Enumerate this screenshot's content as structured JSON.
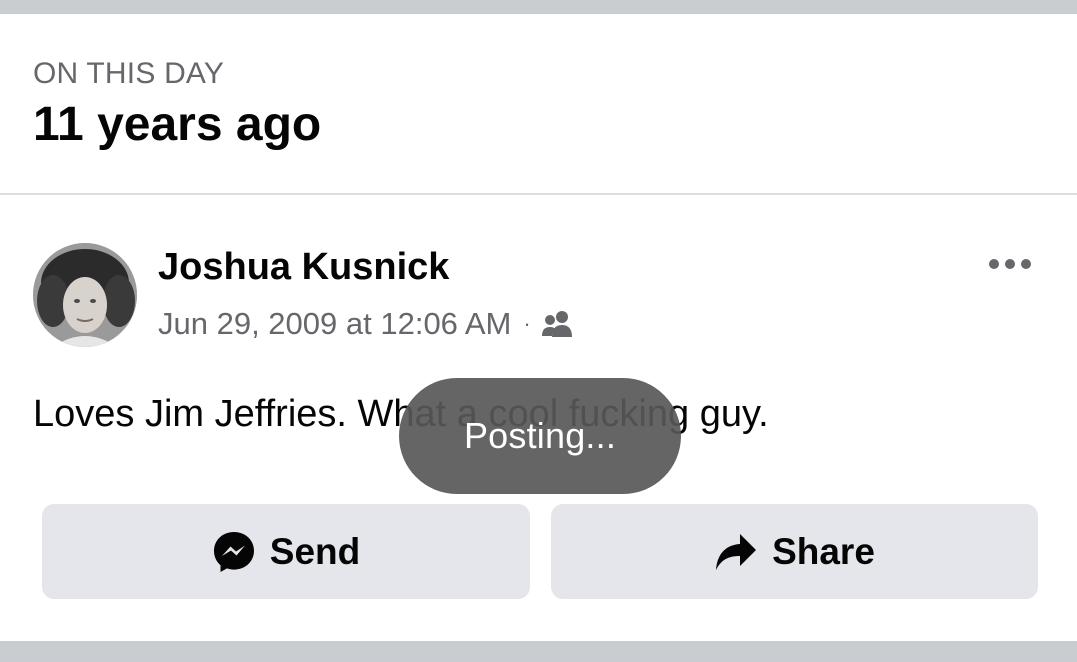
{
  "header": {
    "section_label": "ON THIS DAY",
    "title": "11 years ago"
  },
  "post": {
    "author": "Joshua Kusnick",
    "timestamp": "Jun 29, 2009 at 12:06 AM",
    "separator": "·",
    "audience_icon": "friends-icon",
    "more_icon": "more-options-icon",
    "text": "Loves Jim Jeffries. What a cool fucking guy."
  },
  "actions": {
    "send_label": "Send",
    "send_icon": "messenger-icon",
    "share_label": "Share",
    "share_icon": "share-arrow-icon"
  },
  "toast": {
    "text": "Posting..."
  },
  "colors": {
    "divider_band": "#c9ccd1",
    "secondary_text": "#65676b",
    "primary_text": "#050505",
    "button_bg": "#e4e6eb",
    "toast_bg": "#585858"
  }
}
